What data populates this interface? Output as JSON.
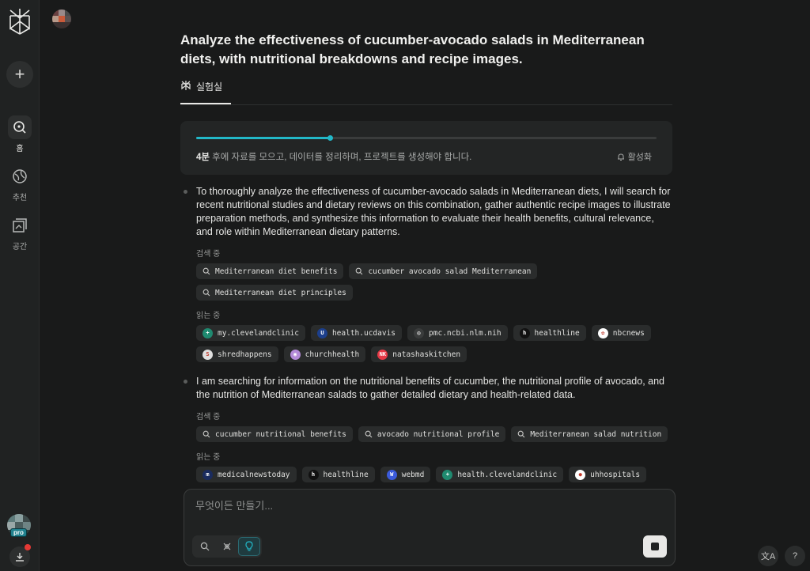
{
  "sidebar": {
    "new_label": "+",
    "items": [
      {
        "label": "홈",
        "icon": "search-home-icon",
        "active": true
      },
      {
        "label": "추천",
        "icon": "globe-icon",
        "active": false
      },
      {
        "label": "공간",
        "icon": "spaces-icon",
        "active": false
      }
    ],
    "pro_label": "pro"
  },
  "main": {
    "title": "Analyze the effectiveness of cucumber-avocado salads in Mediterranean diets, with nutritional breakdowns and recipe images.",
    "tab_label": "실험실",
    "progress": {
      "fraction": 0.29,
      "time_bold": "4분",
      "text": " 후에 자료를 모으고, 데이터를 정리하며, 프로젝트를 생성해야 합니다.",
      "notify_label": "활성화"
    },
    "steps": [
      {
        "text": "To thoroughly analyze the effectiveness of cucumber-avocado salads in Mediterranean diets, I will search for recent nutritional studies and dietary reviews on this combination, gather authentic recipe images to illustrate preparation methods, and synthesize this information to evaluate their health benefits, cultural relevance, and role within Mediterranean dietary patterns.",
        "search_label": "검색 중",
        "searches": [
          "Mediterranean diet benefits",
          "cucumber avocado salad Mediterranean",
          "Mediterranean diet principles"
        ],
        "read_label": "읽는 중",
        "sources": [
          {
            "name": "my.clevelandclinic",
            "color": "#1f8a70",
            "glyph": "+"
          },
          {
            "name": "health.ucdavis",
            "color": "#1c3f8c",
            "glyph": "U"
          },
          {
            "name": "pmc.ncbi.nlm.nih",
            "color": "#3a3c3c",
            "glyph": "◎"
          },
          {
            "name": "healthline",
            "color": "#111111",
            "glyph": "h"
          },
          {
            "name": "nbcnews",
            "color": "#ffffff",
            "glyph": "✿"
          },
          {
            "name": "shredhappens",
            "color": "#e0e0e0",
            "glyph": "S"
          },
          {
            "name": "churchhealth",
            "color": "#b48ad8",
            "glyph": "◉"
          },
          {
            "name": "natashaskitchen",
            "color": "#e53946",
            "glyph": "NK"
          }
        ]
      },
      {
        "text": "I am searching for information on the nutritional benefits of cucumber, the nutritional profile of avocado, and the nutrition of Mediterranean salads to gather detailed dietary and health-related data.",
        "search_label": "검색 중",
        "searches": [
          "cucumber nutritional benefits",
          "avocado nutritional profile",
          "Mediterranean salad nutrition"
        ],
        "read_label": "읽는 중",
        "sources": [
          {
            "name": "medicalnewstoday",
            "color": "#1a2b5e",
            "glyph": "m"
          },
          {
            "name": "healthline",
            "color": "#111111",
            "glyph": "h"
          },
          {
            "name": "webmd",
            "color": "#3b5bdb",
            "glyph": "W"
          },
          {
            "name": "health.clevelandclinic",
            "color": "#1f8a70",
            "glyph": "+"
          },
          {
            "name": "uhhospitals",
            "color": "#ffffff",
            "glyph": "●"
          }
        ]
      }
    ]
  },
  "input": {
    "placeholder": "무엇이든 만들기..."
  },
  "corner": {
    "translate_label": "文A",
    "help_label": "?"
  }
}
